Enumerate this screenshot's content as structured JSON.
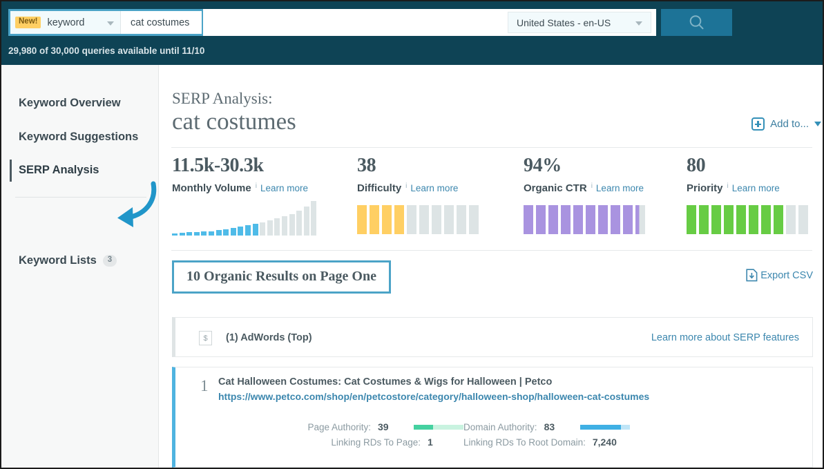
{
  "header": {
    "new_badge": "New!",
    "keyword_select_value": "keyword",
    "keyword_input_value": "cat costumes",
    "locale_value": "United States - en-US",
    "search_icon": "search-icon",
    "quota_text": "29,980 of 30,000 queries available until 11/10"
  },
  "sidebar": {
    "items": [
      {
        "label": "Keyword Overview",
        "active": false
      },
      {
        "label": "Keyword Suggestions",
        "active": false
      },
      {
        "label": "SERP Analysis",
        "active": true
      }
    ],
    "keyword_lists": {
      "label": "Keyword Lists",
      "count": "3"
    }
  },
  "main": {
    "subtitle": "SERP Analysis:",
    "title": "cat costumes",
    "add_to": {
      "label": "Add to...",
      "icon": "plus-in-rounded-square-icon",
      "caret": "chevron-down-icon"
    },
    "learn_more_label": "Learn more",
    "info_glyph": "i"
  },
  "metrics": [
    {
      "value": "11.5k-30.3k",
      "label": "Monthly Volume",
      "learn_more": "Learn more",
      "type": "sparkline",
      "color": "#4fbbe8",
      "spark": {
        "blue_heights": [
          3,
          4,
          5,
          5,
          6,
          6,
          8,
          9,
          11,
          13,
          15,
          17
        ],
        "gray_heights": [
          19,
          22,
          25,
          28,
          31,
          36,
          42,
          50
        ]
      }
    },
    {
      "value": "38",
      "label": "Difficulty",
      "learn_more": "Learn more",
      "type": "blocks",
      "color": "#ffcf63",
      "filled": 4,
      "total": 10
    },
    {
      "value": "94%",
      "label": "Organic CTR",
      "learn_more": "Learn more",
      "type": "blocks",
      "color": "#a993e0",
      "filled": 9,
      "partial": true,
      "total": 10
    },
    {
      "value": "80",
      "label": "Priority",
      "learn_more": "Learn more",
      "type": "blocks",
      "color": "#67cc44",
      "filled": 8,
      "total": 10
    }
  ],
  "results_section": {
    "heading": "10 Organic Results on Page One",
    "export": {
      "label": "Export CSV",
      "icon": "document-download-icon"
    },
    "adwords_row": {
      "icon": "dollar-sign-box-icon",
      "glyph": "$",
      "label": "(1) AdWords (Top)",
      "learn_link": "Learn more about SERP features"
    },
    "results": [
      {
        "rank": "1",
        "title": "Cat Halloween Costumes: Cat Costumes & Wigs for Halloween | Petco",
        "url": "https://www.petco.com/shop/en/petcostore/category/halloween-shop/halloween-cat-costumes",
        "metrics": {
          "page_authority_label": "Page Authority:",
          "page_authority_value": "39",
          "page_authority_pct": 39,
          "domain_authority_label": "Domain Authority:",
          "domain_authority_value": "83",
          "domain_authority_pct": 83,
          "linking_rds_page_label": "Linking RDs To Page:",
          "linking_rds_page_value": "1",
          "linking_rds_root_label": "Linking RDs To Root Domain:",
          "linking_rds_root_value": "7,240"
        }
      }
    ]
  },
  "colors": {
    "header_bg": "#0e4355",
    "accent_blue": "#4ba3c7",
    "link_blue": "#3c87ae",
    "yellow": "#ffcf63",
    "purple": "#a993e0",
    "green": "#67cc44",
    "sparkline_blue": "#4fbbe8"
  }
}
